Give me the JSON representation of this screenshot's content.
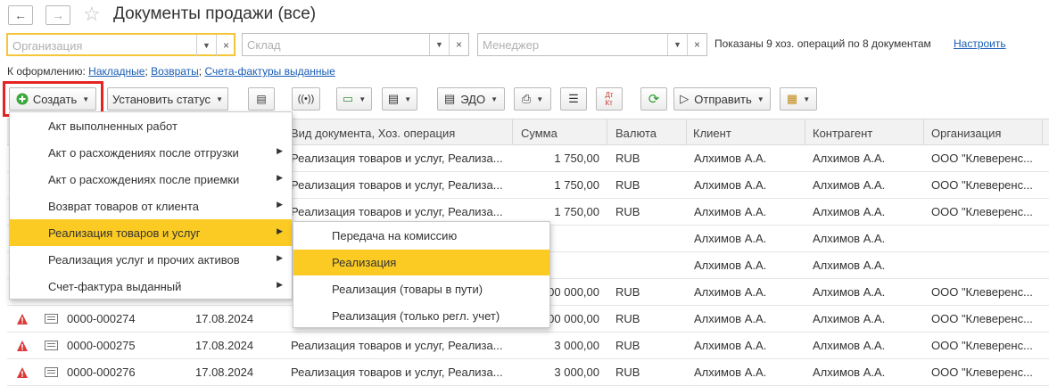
{
  "window": {
    "title": "Документы продажи (все)"
  },
  "filters": {
    "organization_placeholder": "Организация",
    "warehouse_placeholder": "Склад",
    "manager_placeholder": "Менеджер",
    "shown_text": "Показаны 9 хоз. операций по 8 документам",
    "settings_link": "Настроить"
  },
  "to_form": {
    "label": "К оформлению:",
    "links": [
      "Накладные",
      "Возвраты",
      "Счета-фактуры выданные"
    ]
  },
  "toolbar": {
    "create_label": "Создать",
    "set_status_label": "Установить статус",
    "edo_label": "ЭДО",
    "send_label": "Отправить"
  },
  "table": {
    "columns": [
      "Вид документа, Хоз. операция",
      "Сумма",
      "Валюта",
      "Клиент",
      "Контрагент",
      "Организация"
    ],
    "rows": [
      {
        "number": "",
        "date": "",
        "kind": "Реализация товаров и услуг, Реализа...",
        "sum": "1 750,00",
        "currency": "RUB",
        "client": "Алхимов А.А.",
        "counterparty": "Алхимов А.А.",
        "org": "ООО \"Клеверенс..."
      },
      {
        "number": "",
        "date": "",
        "kind": "Реализация товаров и услуг, Реализа...",
        "sum": "1 750,00",
        "currency": "RUB",
        "client": "Алхимов А.А.",
        "counterparty": "Алхимов А.А.",
        "org": "ООО \"Клеверенс..."
      },
      {
        "number": "",
        "date": "",
        "kind": "Реализация товаров и услуг, Реализа...",
        "sum": "1 750,00",
        "currency": "RUB",
        "client": "Алхимов А.А.",
        "counterparty": "Алхимов А.А.",
        "org": "ООО \"Клеверенс..."
      },
      {
        "number": "",
        "date": "",
        "kind": "",
        "sum": "",
        "currency": "",
        "client": "Алхимов А.А.",
        "counterparty": "Алхимов А.А.",
        "org": ""
      },
      {
        "number": "",
        "date": "",
        "kind": "",
        "sum": "",
        "currency": "",
        "client": "Алхимов А.А.",
        "counterparty": "Алхимов А.А.",
        "org": ""
      },
      {
        "number": "",
        "date": "",
        "kind": "",
        "sum": "00 000,00",
        "currency": "RUB",
        "client": "Алхимов А.А.",
        "counterparty": "Алхимов А.А.",
        "org": "ООО \"Клеверенс..."
      },
      {
        "number": "0000-000274",
        "date": "17.08.2024",
        "kind": "",
        "sum": "00 000,00",
        "currency": "RUB",
        "client": "Алхимов А.А.",
        "counterparty": "Алхимов А.А.",
        "org": "ООО \"Клеверенс..."
      },
      {
        "number": "0000-000275",
        "date": "17.08.2024",
        "kind": "Реализация товаров и услуг, Реализа...",
        "sum": "3 000,00",
        "currency": "RUB",
        "client": "Алхимов А.А.",
        "counterparty": "Алхимов А.А.",
        "org": "ООО \"Клеверенс..."
      },
      {
        "number": "0000-000276",
        "date": "17.08.2024",
        "kind": "Реализация товаров и услуг, Реализа...",
        "sum": "3 000,00",
        "currency": "RUB",
        "client": "Алхимов А.А.",
        "counterparty": "Алхимов А.А.",
        "org": "ООО \"Клеверенс..."
      }
    ]
  },
  "create_menu": {
    "items": [
      {
        "label": "Акт выполненных работ",
        "has_sub": false
      },
      {
        "label": "Акт о расхождениях после отгрузки",
        "has_sub": true
      },
      {
        "label": "Акт о расхождениях после приемки",
        "has_sub": true
      },
      {
        "label": "Возврат товаров от клиента",
        "has_sub": true
      },
      {
        "label": "Реализация товаров и услуг",
        "has_sub": true
      },
      {
        "label": "Реализация услуг и прочих активов",
        "has_sub": true
      },
      {
        "label": "Счет-фактура выданный",
        "has_sub": true
      }
    ],
    "submenu": [
      "Передача на комиссию",
      "Реализация",
      "Реализация (товары в пути)",
      "Реализация (только регл. учет)"
    ]
  },
  "colors": {
    "highlight": "#fbcb23",
    "accent_red": "#e52323",
    "link": "#1a5db5"
  }
}
